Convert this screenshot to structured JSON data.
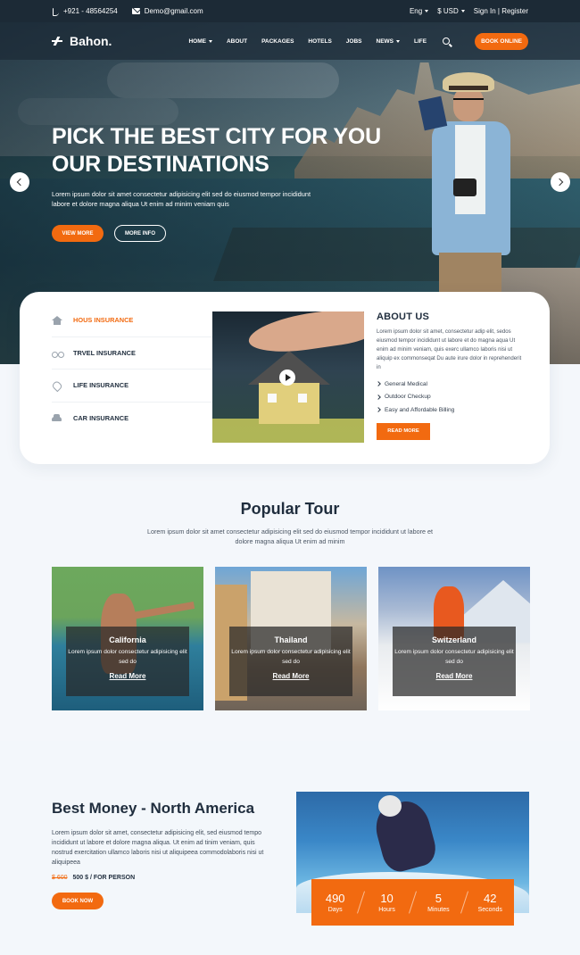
{
  "topbar": {
    "phone": "+921 - 48564254",
    "email": "Demo@gmail.com",
    "language": "Eng",
    "currency": "$ USD",
    "signin": "Sign In",
    "divider": "|",
    "register": "Register"
  },
  "nav": {
    "brand": "Bahon.",
    "items": [
      "HOME",
      "ABOUT",
      "PACKAGES",
      "HOTELS",
      "JOBS",
      "NEWS",
      "LIFE"
    ],
    "book_online": "BOOK ONLINE"
  },
  "hero": {
    "title_line1": "PICK THE BEST CITY FOR YOU",
    "title_line2": "OUR DESTINATIONS",
    "text": "Lorem ipsum dolor sit amet consectetur adipisicing elit sed do eiusmod tempor incididunt labore et dolore magna aliqua Ut enim ad minim veniam quis",
    "view_more": "VIEW MORE",
    "more_info": "MORE INFO"
  },
  "insurance": {
    "items": [
      "HOUS INSURANCE",
      "TRVEL INSURANCE",
      "LIFE INSURANCE",
      "CAR INSURANCE"
    ]
  },
  "about": {
    "title": "ABOUT US",
    "text": "Lorem ipsum dolor sit amet, consectetur adip elit, sedos eiusmod tempor incididunt ut labore et do magna aqua Ut enim ad minim veniam, quis exerc ullamco laboris nisi ut aliquip ex commonseqat Du aute irure dolor in reprehenderit in",
    "bullets": [
      "General Medical",
      "Outdoor Checkup",
      "Easy and Affordable Billing"
    ],
    "read_more": "READ MORE"
  },
  "popular": {
    "title": "Popular Tour",
    "subtitle": "Lorem ipsum dolor sit amet consectetur adipisicing elit sed do eiusmod tempor incididunt ut labore et dolore magna aliqua Ut enim ad minim",
    "tours": [
      {
        "name": "California",
        "text": "Lorem ipsum dolor consectetur adipisicing elit sed do",
        "link": "Read More"
      },
      {
        "name": "Thailand",
        "text": "Lorem ipsum dolor consectetur adipisicing elit sed do",
        "link": "Read More"
      },
      {
        "name": "Switzerland",
        "text": "Lorem ipsum dolor consectetur adipisicing elit sed do",
        "link": "Read More"
      }
    ]
  },
  "best_money": {
    "title": "Best Money - North America",
    "text": "Lorem ipsum dolor sit amet, consectetur adipisicing elit, sed eiusmod tempo incididunt ut labore et dolore magna aliqua. Ut enim ad tinim veniam, quis nostrud exercitation ullamco laboris nisi ut aliquipeea commodolaboris nisi ut aliquipeea",
    "old_price": "$ 600",
    "price": "500 $ / FOR PERSON",
    "book_now": "BOOK NOW",
    "counter": [
      {
        "value": "490",
        "label": "Days"
      },
      {
        "value": "10",
        "label": "Hours"
      },
      {
        "value": "5",
        "label": "Minutes"
      },
      {
        "value": "42",
        "label": "Seconds"
      }
    ]
  },
  "colors": {
    "accent": "#f26a10",
    "dark": "#1c2a36"
  }
}
